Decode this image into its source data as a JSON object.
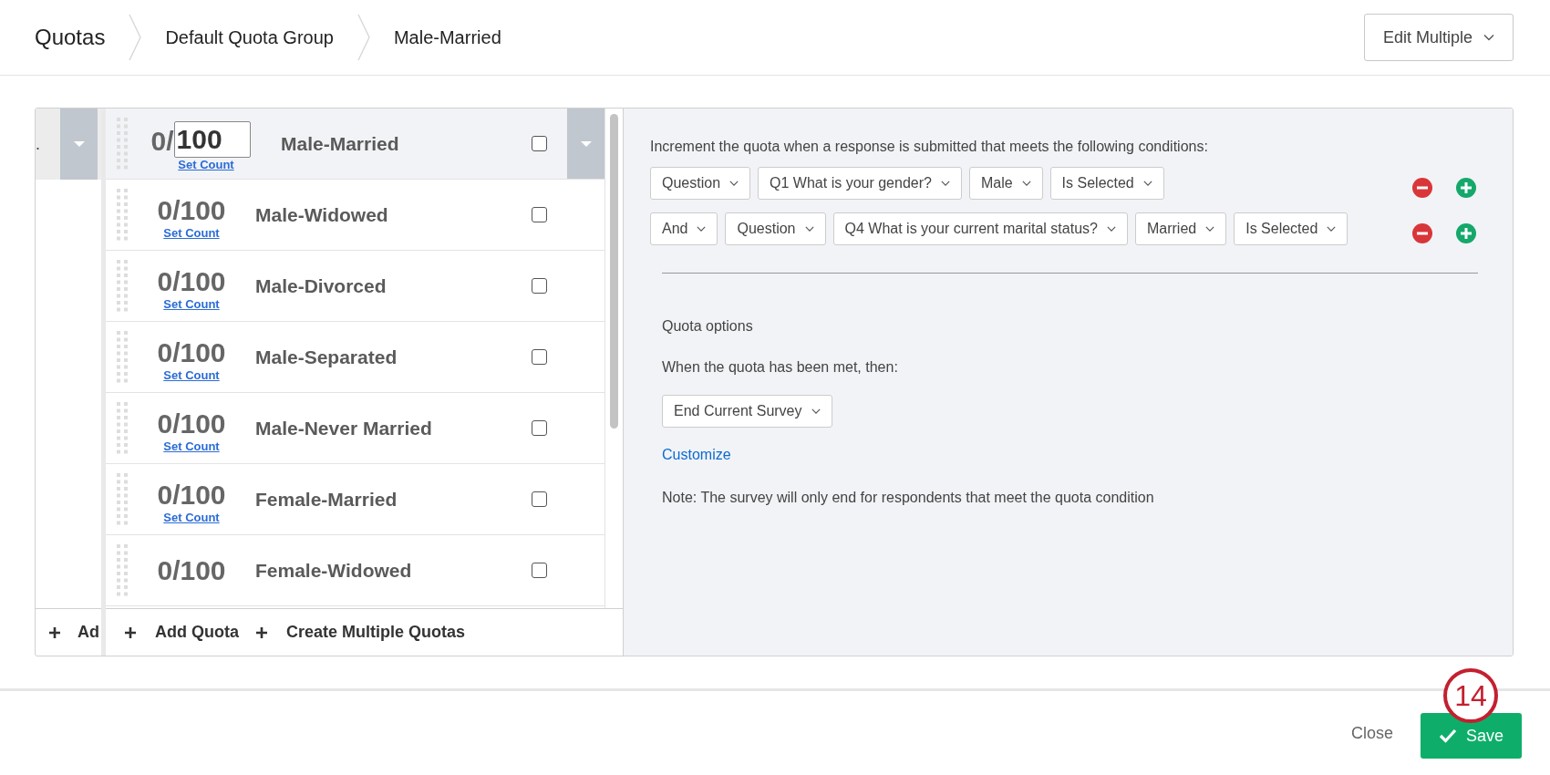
{
  "breadcrumb": [
    {
      "label": "Quotas"
    },
    {
      "label": "Default Quota Group"
    },
    {
      "label": "Male-Married"
    }
  ],
  "edit_multiple": {
    "label": "Edit Multiple"
  },
  "group_column": {
    "label_fragment": ".",
    "add_fragment": "Ad"
  },
  "quotas": [
    {
      "kind": "editing",
      "count": "0/",
      "limit": "100",
      "set_count": "Set Count",
      "name": "Male-Married",
      "selected": true,
      "checked": false
    },
    {
      "kind": "display",
      "count": "0/100",
      "set_count": "Set Count",
      "name": "Male-Widowed",
      "selected": false,
      "checked": false
    },
    {
      "kind": "display",
      "count": "0/100",
      "set_count": "Set Count",
      "name": "Male-Divorced",
      "selected": false,
      "checked": false
    },
    {
      "kind": "display",
      "count": "0/100",
      "set_count": "Set Count",
      "name": "Male-Separated",
      "selected": false,
      "checked": false
    },
    {
      "kind": "display",
      "count": "0/100",
      "set_count": "Set Count",
      "name": "Male-Never Married",
      "selected": false,
      "checked": false
    },
    {
      "kind": "display",
      "count": "0/100",
      "set_count": "Set Count",
      "name": "Female-Married",
      "selected": false,
      "checked": false
    },
    {
      "kind": "display",
      "count": "0/100",
      "name": "Female-Widowed",
      "selected": false,
      "checked": false
    }
  ],
  "list_actions": [
    "Add Quota",
    "Create Multiple Quotas"
  ],
  "conditions": {
    "intro": "Increment the quota when a response is submitted that meets the following conditions:",
    "rows": [
      {
        "fields": [
          "Question",
          "Q1 What is your gender?",
          "Male",
          "Is Selected"
        ]
      },
      {
        "fields": [
          "And",
          "Question",
          "Q4 What is your current marital status?",
          "Married",
          "Is Selected"
        ]
      }
    ]
  },
  "quota_options": {
    "heading": "Quota options",
    "prompt": "When the quota has been met, then:",
    "action": "End Current Survey",
    "customize": "Customize",
    "note": "Note: The survey will only end for respondents that meet the quota condition"
  },
  "footer": {
    "close": "Close",
    "save": "Save"
  },
  "callout": {
    "number": "14"
  }
}
